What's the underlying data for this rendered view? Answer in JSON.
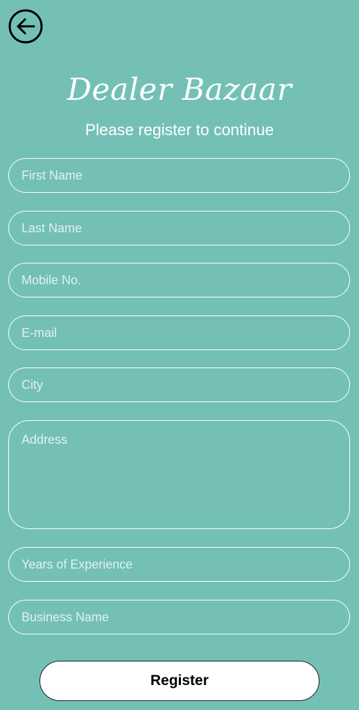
{
  "header": {
    "back_icon": "arrow-left-circle-icon",
    "brand": "Dealer Bazaar",
    "subtitle": "Please register to continue"
  },
  "form": {
    "first_name": {
      "placeholder": "First Name",
      "value": ""
    },
    "last_name": {
      "placeholder": "Last Name",
      "value": ""
    },
    "mobile": {
      "placeholder": "Mobile No.",
      "value": ""
    },
    "email": {
      "placeholder": "E-mail",
      "value": ""
    },
    "city": {
      "placeholder": "City",
      "value": ""
    },
    "address": {
      "placeholder": "Address",
      "value": ""
    },
    "experience": {
      "placeholder": "Years of Experience",
      "value": ""
    },
    "business_name": {
      "placeholder": "Business Name",
      "value": ""
    }
  },
  "actions": {
    "register_label": "Register"
  },
  "colors": {
    "background": "#74c0b5",
    "text": "#ffffff",
    "button_bg": "#ffffff",
    "button_text": "#000000"
  }
}
